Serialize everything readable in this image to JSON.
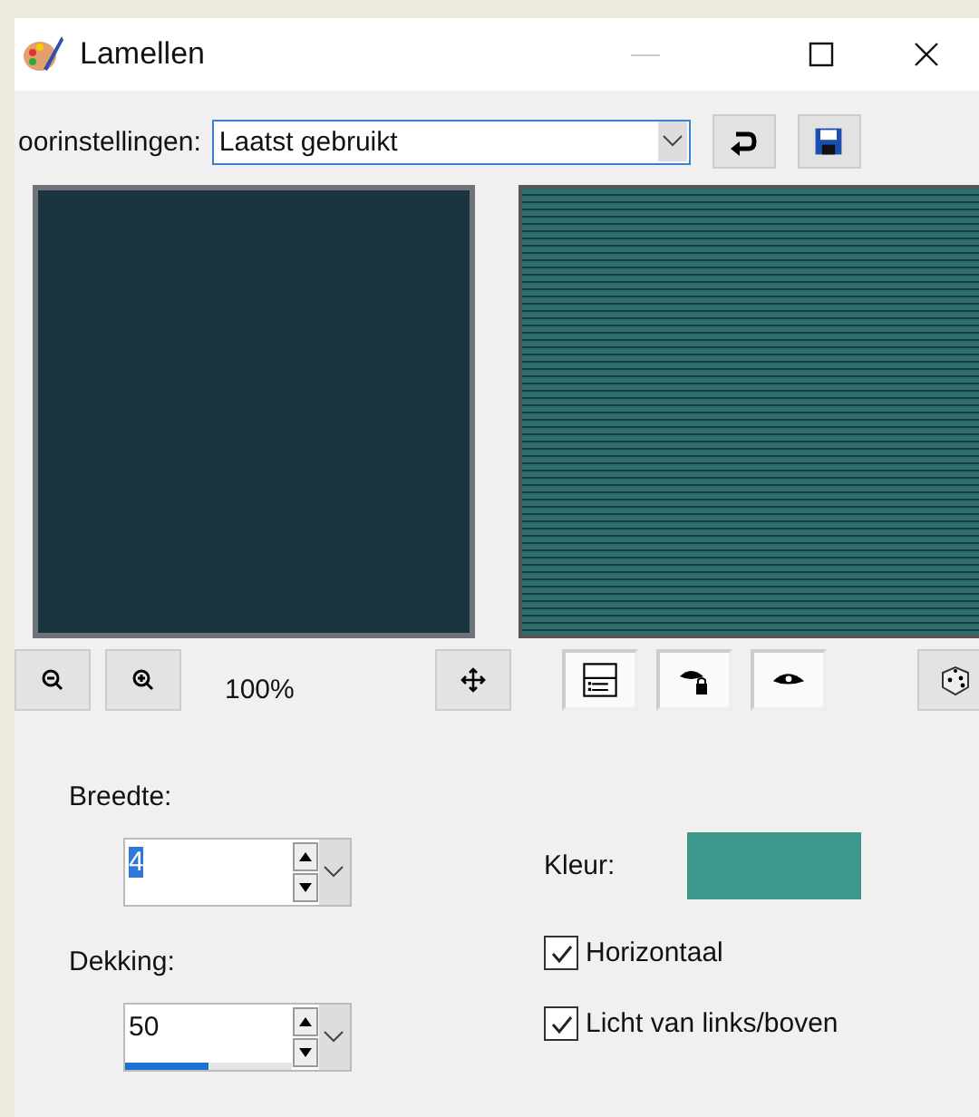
{
  "window": {
    "title": "Lamellen"
  },
  "presets": {
    "label": "oorinstellingen:",
    "value": "Laatst gebruikt"
  },
  "zoom": {
    "reading": "100%"
  },
  "toggles": [
    {
      "kind": "proof",
      "pressed": true
    },
    {
      "kind": "lock-eye",
      "pressed": true
    },
    {
      "kind": "eye",
      "pressed": true
    }
  ],
  "breedte": {
    "label": "Breedte:",
    "value": "4"
  },
  "dekking": {
    "label": "Dekking:",
    "value": "50",
    "level": 0.5
  },
  "kleur": {
    "label": "Kleur:",
    "color": "#3d978b"
  },
  "options": [
    {
      "label": "Horizontaal",
      "checked": true
    },
    {
      "label": "Licht van links/boven",
      "checked": true
    }
  ]
}
